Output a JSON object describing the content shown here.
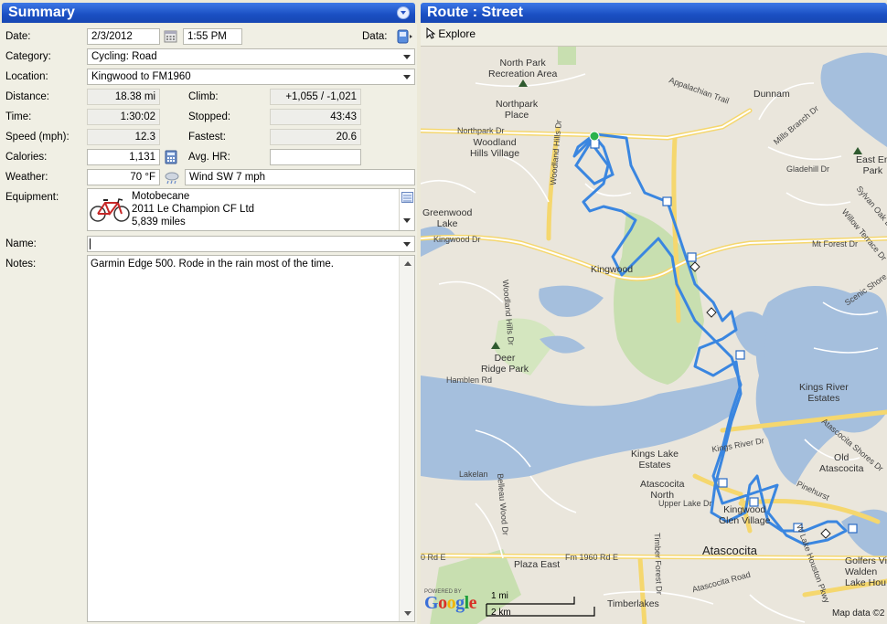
{
  "summary": {
    "title": "Summary",
    "date_label": "Date:",
    "date": "2/3/2012",
    "time_of_day": "1:55 PM",
    "data_label": "Data:",
    "category_label": "Category:",
    "category": "Cycling: Road",
    "location_label": "Location:",
    "location": "Kingwood to FM1960",
    "distance_label": "Distance:",
    "distance": "18.38 mi",
    "climb_label": "Climb:",
    "climb": "+1,055 / -1,021",
    "time_label": "Time:",
    "time": "1:30:02",
    "stopped_label": "Stopped:",
    "stopped": "43:43",
    "speed_label": "Speed (mph):",
    "speed": "12.3",
    "fastest_label": "Fastest:",
    "fastest": "20.6",
    "calories_label": "Calories:",
    "calories": "1,131",
    "avg_hr_label": "Avg. HR:",
    "avg_hr": "",
    "weather_label": "Weather:",
    "temperature": "70 °F",
    "weather": "Wind SW 7 mph",
    "equipment_label": "Equipment:",
    "equipment": {
      "name": "Motobecane",
      "model": "2011 Le Champion CF Ltd",
      "miles": "5,839 miles"
    },
    "name_label": "Name:",
    "name": "",
    "notes_label": "Notes:",
    "notes": "Garmin Edge 500. Rode in the rain most of the time."
  },
  "route": {
    "title": "Route : Street",
    "explore_label": "Explore",
    "labels": {
      "north_park_rec": "North Park\nRecreation Area",
      "northpark_place": "Northpark\nPlace",
      "woodland_hills": "Woodland\nHills Village",
      "dunnam": "Dunnam",
      "east_end_park": "East En\nPark",
      "greenwood_lake": "Greenwood\nLake",
      "kingwood": "Kingwood",
      "deer_ridge": "Deer\nRidge Park",
      "hamblen_rd": "Hamblen Rd",
      "kings_river": "Kings River\nEstates",
      "kings_lake": "Kings Lake\nEstates",
      "atascocita_north": "Atascocita\nNorth",
      "old_atascocita": "Old\nAtascocita",
      "kingwood_glen": "Kingwood\nGlen Village",
      "atascocita": "Atascocita",
      "plaza_east": "Plaza East",
      "timberlakes": "Timberlakes",
      "golfers": "Golfers Vi\nWalden\nLake Hou",
      "lakelan": "Lakelan",
      "northpark_dr": "Northpark Dr",
      "kingwood_dr": "Kingwood Dr",
      "fm1960": "Fm 1960 Rd E",
      "upper_lake": "Upper Lake Dr",
      "woodland_hills_dr": "Woodland Hills Dr",
      "timber_forest": "Timber Forest Dr",
      "mills_branch": "Mills Branch Dr",
      "appalachian": "Appalachian Trail",
      "gladehill": "Gladehill Dr",
      "mt_forest": "Mt Forest Dr",
      "kings_river_dr": "Kings River Dr",
      "pinehurst": "Pinehurst",
      "atascocita_shores": "Atascocita Shores Dr",
      "atascocita_road": "Atascocita Road",
      "lake_houston_pkwy": "W Lake Houston Pkwy",
      "willow_terrace": "Willow Terrace Dr",
      "scenic_shore": "Scenic Shore",
      "sylvan_oak": "Sylvan Oak Dr",
      "deer_ridge_dr": "Woodland Hills Dr",
      "belleau_wood": "Belleau Wood Dr",
      "hamblen_left": "0 Rd E"
    },
    "scale_mi": "1 mi",
    "scale_km": "2 km",
    "powered_by": "POWERED BY",
    "google": "Google",
    "map_data": "Map data ©2"
  }
}
